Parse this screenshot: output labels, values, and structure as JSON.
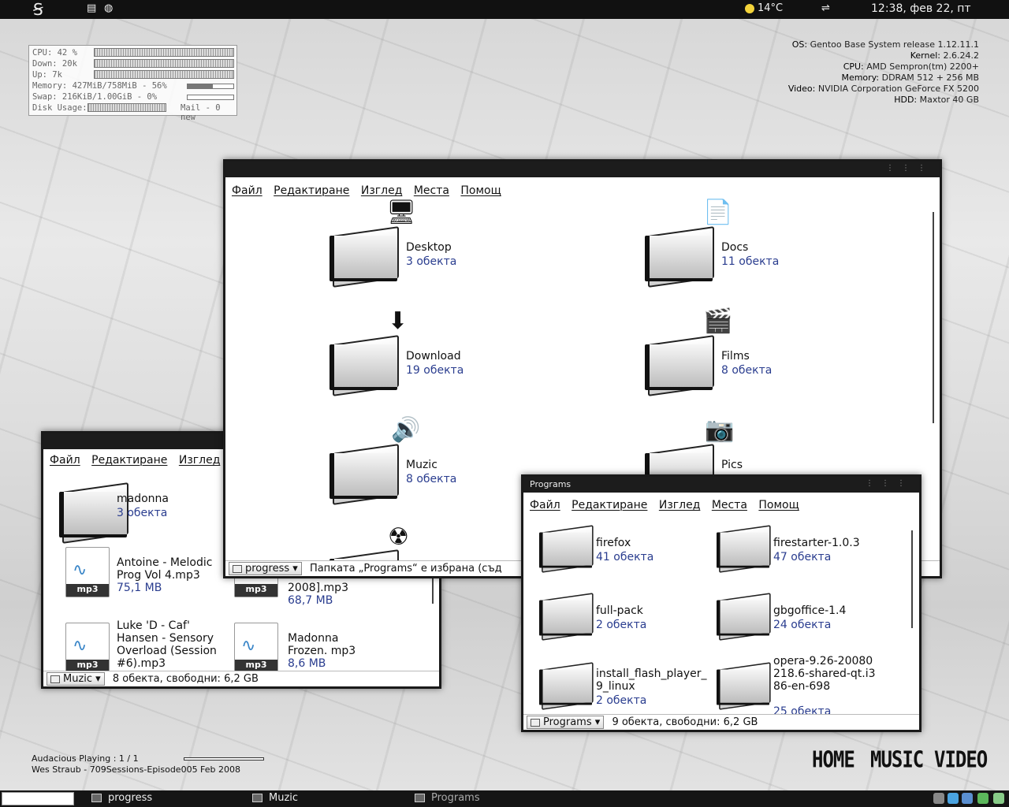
{
  "top_panel": {
    "weather": "14°C",
    "clock": "12:38, фев 22, пт"
  },
  "conky": {
    "cpu": "CPU: 42 %",
    "down": "Down: 20k",
    "up": "Up: 7k",
    "memory": "Memory: 427MiB/758MiB - 56%",
    "memory_percent": 56,
    "swap": "Swap: 216KiB/1.00GiB - 0%",
    "swap_percent": 0,
    "disk": "Disk Usage:",
    "mail": "Mail - 0 new"
  },
  "sysinfo": {
    "os_label": "OS:",
    "os": "Gentoo Base System release 1.12.11.1",
    "kernel_label": "Kernel:",
    "kernel": "2.6.24.2",
    "cpu_label": "CPU:",
    "cpu": "AMD Sempron(tm) 2200+",
    "memory_label": "Memory:",
    "memory": "DDRAM 512 + 256 MB",
    "video_label": "Video:",
    "video": "NVIDIA Corporation GeForce FX 5200",
    "hdd_label": "HDD:",
    "hdd": "Maxtor 40 GB"
  },
  "menu": {
    "file": "Файл",
    "edit": "Редактиране",
    "view": "Изглед",
    "places": "Места",
    "help": "Помощ"
  },
  "progress_window": {
    "folders": [
      {
        "name": "Desktop",
        "count": "3 обекта"
      },
      {
        "name": "Docs",
        "count": "11 обекта"
      },
      {
        "name": "Download",
        "count": "19 обекта"
      },
      {
        "name": "Films",
        "count": "8 обекта"
      },
      {
        "name": "Muzic",
        "count": "8 обекта"
      },
      {
        "name": "Pics",
        "count": ""
      }
    ],
    "location": "progress",
    "status": "Папката „Programs“ е избрана (съд"
  },
  "muzic_window": {
    "items": [
      {
        "name": "madonna",
        "count": "3 обекта"
      },
      {
        "name": "Antoine - Melodic Prog Vol 4.mp3",
        "size": "75,1 MB"
      },
      {
        "name": "2008].mp3",
        "size": "68,7 MB"
      },
      {
        "name": "Luke 'D - Caf' Hansen - Sensory Overload (Session #6).mp3",
        "size": ""
      },
      {
        "name": "Madonna Frozen. mp3",
        "size": "8,6 MB"
      }
    ],
    "mp3_label": "mp3",
    "location": "Muzic",
    "status": "8 обекта, свободни: 6,2 GB"
  },
  "programs_window": {
    "title": "Programs",
    "items": [
      {
        "name": "firefox",
        "count": "41 обекта"
      },
      {
        "name": "firestarter-1.0.3",
        "count": "47 обекта"
      },
      {
        "name": "full-pack",
        "count": "2 обекта"
      },
      {
        "name": "gbgoffice-1.4",
        "count": "24 обекта"
      },
      {
        "name": "install_flash_player_ 9_linux",
        "count": "2 обекта"
      },
      {
        "name": "opera-9.26-20080218.6-shared-qt.i386-en-698",
        "count": "25 обекта"
      }
    ],
    "location": "Programs",
    "status": "9 обекта, свободни: 6,2 GB"
  },
  "audacious": {
    "line1": "Audacious Playing : 1 / 1",
    "line2": "Wes Straub - 709Sessions-Episode005 Feb 2008"
  },
  "nav_links": {
    "home": "HOME",
    "music": "MUSIC",
    "video": "VIDEO"
  },
  "taskbar": {
    "task1": "progress",
    "task2": "Muzic",
    "task3": "Programs"
  }
}
